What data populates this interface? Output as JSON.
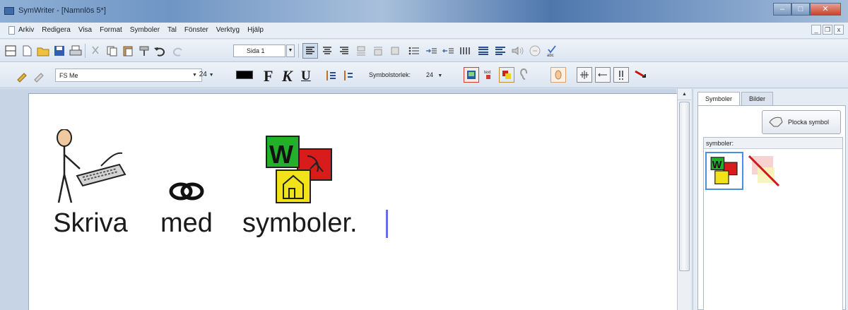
{
  "window": {
    "title": "SymWriter - [Namnlös 5*]",
    "controls": {
      "minimize": "–",
      "maximize": "□",
      "close": "✕"
    }
  },
  "menu": {
    "items": [
      "Arkiv",
      "Redigera",
      "Visa",
      "Format",
      "Symboler",
      "Tal",
      "Fönster",
      "Verktyg",
      "Hjälp"
    ],
    "mdi_controls": {
      "minimize": "_",
      "restore": "❐",
      "close": "x"
    }
  },
  "toolbar1": {
    "page_selector": "Sida 1"
  },
  "toolbar2": {
    "font_name": "FS Me",
    "font_size": "24",
    "bold_label": "F",
    "italic_label": "K",
    "underline_label": "U",
    "symbol_size_label": "Symbolstorlek:",
    "symbol_size_value": "24"
  },
  "document": {
    "words": [
      {
        "text": "Skriva",
        "symbol": "person-typing"
      },
      {
        "text": "med",
        "symbol": "linked-rings"
      },
      {
        "text": "symboler.",
        "symbol": "widgit-logo"
      }
    ]
  },
  "side_panel": {
    "tabs": [
      "Symboler",
      "Bilder"
    ],
    "active_tab": "Symboler",
    "pick_button_label": "Plocka symbol",
    "symbols_label": "symboler:"
  },
  "colors": {
    "text_color_swatch": "#000000",
    "cursor": "#6670e0",
    "selection_border": "#4a8fe0",
    "logo_green": "#22b02b",
    "logo_red": "#d81c1c",
    "logo_yellow": "#f2e21a"
  }
}
